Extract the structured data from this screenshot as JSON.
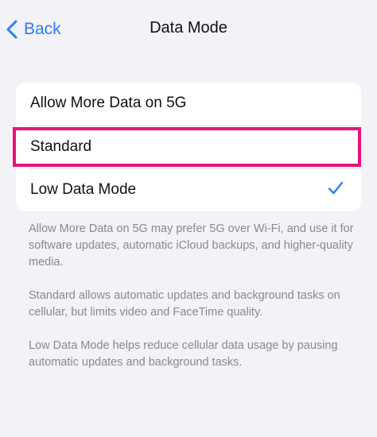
{
  "nav": {
    "back_label": "Back",
    "title": "Data Mode"
  },
  "options": [
    {
      "label": "Allow More Data on 5G",
      "selected": false
    },
    {
      "label": "Standard",
      "selected": false
    },
    {
      "label": "Low Data Mode",
      "selected": true
    }
  ],
  "footnotes": [
    "Allow More Data on 5G may prefer 5G over Wi-Fi, and use it for software updates, automatic iCloud backups, and higher-quality media.",
    "Standard allows automatic updates and background tasks on cellular, but limits video and FaceTime quality.",
    "Low Data Mode helps reduce cellular data usage by pausing automatic updates and background tasks."
  ],
  "colors": {
    "accent": "#2f7cf6",
    "highlight": "#e8137a",
    "background": "#f2f2f7",
    "footnote_text": "#8a8a8e"
  }
}
